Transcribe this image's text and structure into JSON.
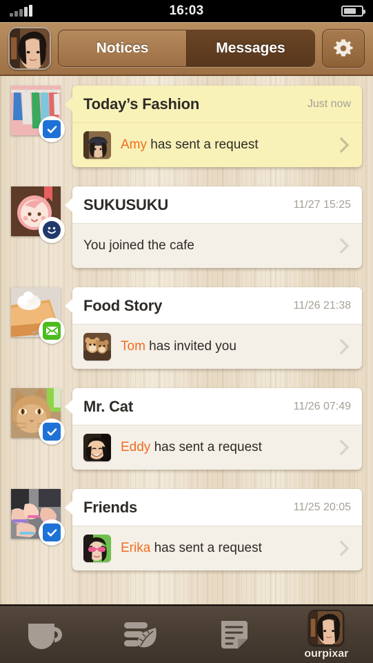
{
  "status_bar": {
    "time": "16:03",
    "signal_icon": "signal-bars-icon",
    "battery_icon": "battery-icon"
  },
  "header": {
    "profile_avatar_icon": "profile-avatar",
    "tabs": [
      {
        "label": "Notices",
        "active": false
      },
      {
        "label": "Messages",
        "active": true
      }
    ],
    "settings_icon": "gear-icon"
  },
  "messages": [
    {
      "title": "Today’s Fashion",
      "time": "Just now",
      "highlighted": true,
      "thumb_name": "thumbnail-clothes-rack",
      "badge": "check",
      "badge_name": "check-badge-icon",
      "avatar_name": "avatar-amy",
      "sender": "Amy",
      "action": " has sent a request"
    },
    {
      "title": "SUKUSUKU",
      "time": "11/27 15:25",
      "highlighted": false,
      "thumb_name": "thumbnail-baby-face",
      "badge": "smile",
      "badge_name": "smile-badge-icon",
      "avatar_name": "",
      "sender": "",
      "action": "You joined the cafe"
    },
    {
      "title": "Food Story",
      "time": "11/26 21:38",
      "highlighted": false,
      "thumb_name": "thumbnail-pumpkin-pie",
      "badge": "mail",
      "badge_name": "mail-badge-icon",
      "avatar_name": "avatar-tom",
      "sender": "Tom",
      "action": " has invited you"
    },
    {
      "title": "Mr. Cat",
      "time": "11/26 07:49",
      "highlighted": false,
      "thumb_name": "thumbnail-cat",
      "badge": "check",
      "badge_name": "check-badge-icon",
      "avatar_name": "avatar-eddy",
      "sender": "Eddy",
      "action": " has sent a request"
    },
    {
      "title": "Friends",
      "time": "11/25 20:05",
      "highlighted": false,
      "thumb_name": "thumbnail-friends-hands",
      "badge": "check",
      "badge_name": "check-badge-icon",
      "avatar_name": "avatar-erika",
      "sender": "Erika",
      "action": " has sent a request"
    }
  ],
  "tabbar": {
    "items": [
      {
        "icon": "coffee-cup-icon",
        "label": ""
      },
      {
        "icon": "leaf-stack-icon",
        "label": ""
      },
      {
        "icon": "note-page-icon",
        "label": ""
      }
    ],
    "user": {
      "name": "ourpixar",
      "avatar_icon": "user-avatar"
    }
  },
  "colors": {
    "accent_orange": "#f26c1e",
    "highlight_yellow": "#f8f2b8",
    "header_brown": "#ab7f52",
    "tabbar_brown": "#4a3e33",
    "badge_blue": "#1e72d6",
    "badge_green": "#4cbc1e",
    "badge_navy": "#22386b"
  }
}
